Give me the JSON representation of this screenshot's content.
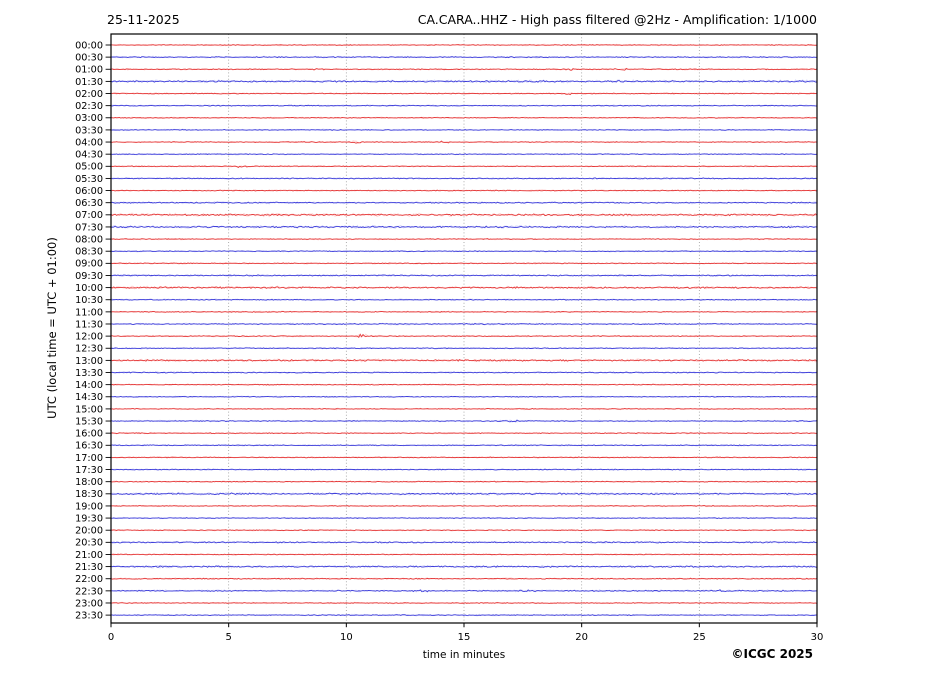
{
  "header": {
    "date": "25-11-2025",
    "title": "CA.CARA..HHZ - High pass filtered @2Hz - Amplification: 1/1000"
  },
  "footer": {
    "credit": "©ICGC 2025"
  },
  "chart_data": {
    "type": "line",
    "subtype": "helicorder-drum-record",
    "station": "CA.CARA..HHZ",
    "processing": "High pass filtered @2Hz",
    "amplification": "1/1000",
    "date": "25-11-2025",
    "title": "CA.CARA..HHZ - High pass filtered @2Hz - Amplification: 1/1000",
    "xlabel": "time in minutes",
    "ylabel": "UTC (local time = UTC + 01:00)",
    "xlim": [
      0,
      30
    ],
    "x_ticks": [
      0,
      5,
      10,
      15,
      20,
      25,
      30
    ],
    "grid": "vertical-dotted-at-5min",
    "row_interval_minutes": 30,
    "legend_position": "none",
    "colors": {
      "hour_rows": "#e33030",
      "half_hour_rows": "#3737d8",
      "hour_rows_halo": "#ffb3b3",
      "half_hour_rows_halo": "#b8b8f5",
      "grid": "#999999",
      "frame": "#000000"
    },
    "rows": [
      {
        "time": "00:00",
        "color": "red",
        "noise": 1.0
      },
      {
        "time": "00:30",
        "color": "blue",
        "noise": 1.25
      },
      {
        "time": "01:00",
        "color": "red",
        "noise": 1.1
      },
      {
        "time": "01:30",
        "color": "blue",
        "noise": 1.9
      },
      {
        "time": "02:00",
        "color": "red",
        "noise": 1.0
      },
      {
        "time": "02:30",
        "color": "blue",
        "noise": 1.1
      },
      {
        "time": "03:00",
        "color": "red",
        "noise": 1.0
      },
      {
        "time": "03:30",
        "color": "blue",
        "noise": 1.0
      },
      {
        "time": "04:00",
        "color": "red",
        "noise": 1.0
      },
      {
        "time": "04:30",
        "color": "blue",
        "noise": 1.0
      },
      {
        "time": "05:00",
        "color": "red",
        "noise": 1.0
      },
      {
        "time": "05:30",
        "color": "blue",
        "noise": 1.2
      },
      {
        "time": "06:00",
        "color": "red",
        "noise": 1.0
      },
      {
        "time": "06:30",
        "color": "blue",
        "noise": 1.4
      },
      {
        "time": "07:00",
        "color": "red",
        "noise": 2.1
      },
      {
        "time": "07:30",
        "color": "blue",
        "noise": 1.9
      },
      {
        "time": "08:00",
        "color": "red",
        "noise": 1.0
      },
      {
        "time": "08:30",
        "color": "blue",
        "noise": 1.0
      },
      {
        "time": "09:00",
        "color": "red",
        "noise": 1.0
      },
      {
        "time": "09:30",
        "color": "blue",
        "noise": 1.4
      },
      {
        "time": "10:00",
        "color": "red",
        "noise": 1.9
      },
      {
        "time": "10:30",
        "color": "blue",
        "noise": 1.1
      },
      {
        "time": "11:00",
        "color": "red",
        "noise": 1.0
      },
      {
        "time": "11:30",
        "color": "blue",
        "noise": 1.3
      },
      {
        "time": "12:00",
        "color": "red",
        "noise": 1.0
      },
      {
        "time": "12:30",
        "color": "blue",
        "noise": 1.1
      },
      {
        "time": "13:00",
        "color": "red",
        "noise": 1.9
      },
      {
        "time": "13:30",
        "color": "blue",
        "noise": 1.2
      },
      {
        "time": "14:00",
        "color": "red",
        "noise": 1.0
      },
      {
        "time": "14:30",
        "color": "blue",
        "noise": 1.0
      },
      {
        "time": "15:00",
        "color": "red",
        "noise": 1.0
      },
      {
        "time": "15:30",
        "color": "blue",
        "noise": 1.1
      },
      {
        "time": "16:00",
        "color": "red",
        "noise": 1.0
      },
      {
        "time": "16:30",
        "color": "blue",
        "noise": 1.1
      },
      {
        "time": "17:00",
        "color": "red",
        "noise": 1.0
      },
      {
        "time": "17:30",
        "color": "blue",
        "noise": 1.0
      },
      {
        "time": "18:00",
        "color": "red",
        "noise": 1.0
      },
      {
        "time": "18:30",
        "color": "blue",
        "noise": 1.9
      },
      {
        "time": "19:00",
        "color": "red",
        "noise": 1.0
      },
      {
        "time": "19:30",
        "color": "blue",
        "noise": 1.0
      },
      {
        "time": "20:00",
        "color": "red",
        "noise": 1.0
      },
      {
        "time": "20:30",
        "color": "blue",
        "noise": 1.55
      },
      {
        "time": "21:00",
        "color": "red",
        "noise": 1.0
      },
      {
        "time": "21:30",
        "color": "blue",
        "noise": 1.9
      },
      {
        "time": "22:00",
        "color": "red",
        "noise": 1.2
      },
      {
        "time": "22:30",
        "color": "blue",
        "noise": 1.35
      },
      {
        "time": "23:00",
        "color": "red",
        "noise": 1.0
      },
      {
        "time": "23:30",
        "color": "blue",
        "noise": 1.0
      }
    ],
    "events": [
      {
        "time": "01:00",
        "start": 8.2,
        "end": 9.1,
        "amp": 1.6
      },
      {
        "time": "01:00",
        "start": 19.2,
        "end": 19.7,
        "amp": 1.3
      },
      {
        "time": "01:00",
        "start": 21.3,
        "end": 21.9,
        "amp": 1.3
      },
      {
        "time": "02:00",
        "start": 19.3,
        "end": 19.55,
        "amp": 1.5
      },
      {
        "time": "04:00",
        "start": 10.2,
        "end": 10.6,
        "amp": 1.8
      },
      {
        "time": "04:00",
        "start": 14.0,
        "end": 14.4,
        "amp": 1.8
      },
      {
        "time": "05:00",
        "start": 5.3,
        "end": 5.8,
        "amp": 1.3
      },
      {
        "time": "12:00",
        "start": 10.5,
        "end": 10.85,
        "amp": 4.0
      },
      {
        "time": "15:30",
        "start": 16.9,
        "end": 17.3,
        "amp": 1.4
      },
      {
        "time": "22:30",
        "start": 12.8,
        "end": 13.5,
        "amp": 1.2
      },
      {
        "time": "22:30",
        "start": 17.4,
        "end": 18.2,
        "amp": 1.2
      },
      {
        "time": "22:30",
        "start": 25.5,
        "end": 26.2,
        "amp": 1.2
      }
    ]
  }
}
